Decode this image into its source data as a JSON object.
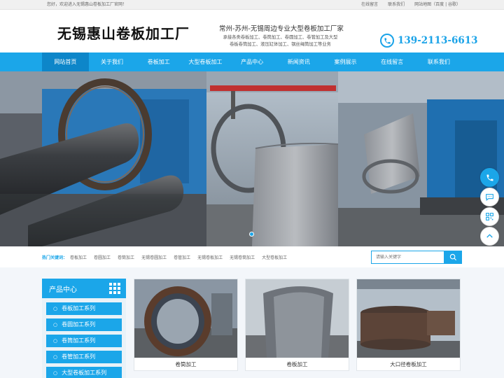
{
  "topbar": {
    "welcome": "您好，欢迎进入无锡惠山卷板加工厂官网！",
    "links": [
      "在线留言",
      "联系我们",
      "网站地图（百度 | 谷歌）"
    ]
  },
  "header": {
    "logo": "无锡惠山卷板加工厂",
    "slogan": "常州-苏州-无锡周边专业大型卷板加工厂家",
    "description": "承接各类卷板加工、卷筒加工、卷圆加工、卷管加工及大型卷板卷筒加工、液压缸体加工、钢丝绳筒加工等业务",
    "phone": "139-2113-6613"
  },
  "nav": {
    "items": [
      "网站首页",
      "关于我们",
      "卷板加工",
      "大型卷板加工",
      "产品中心",
      "新闻资讯",
      "案例展示",
      "在线留言",
      "联系我们"
    ]
  },
  "keywords": {
    "title": "热门关键词：",
    "items": [
      "卷板加工",
      "卷圆加工",
      "卷筒加工",
      "无锡卷圆加工",
      "卷管加工",
      "无锡卷板加工",
      "无锡卷筒加工",
      "大型卷板加工"
    ]
  },
  "search": {
    "placeholder": "请输入关键字"
  },
  "sidebar": {
    "title": "产品中心",
    "items": [
      "卷板加工系列",
      "卷圆加工系列",
      "卷筒加工系列",
      "卷管加工系列",
      "大型卷板加工系列"
    ]
  },
  "products": [
    {
      "caption": "卷筒加工"
    },
    {
      "caption": "卷板加工"
    },
    {
      "caption": "大口径卷板加工"
    }
  ],
  "colors": {
    "accent": "#1ba6e9",
    "nav_active": "#0d86c9"
  },
  "icons": [
    "phone-icon",
    "search-icon",
    "grid-icon",
    "phone-float-icon",
    "chat-icon",
    "qrcode-icon",
    "back-top-icon"
  ]
}
